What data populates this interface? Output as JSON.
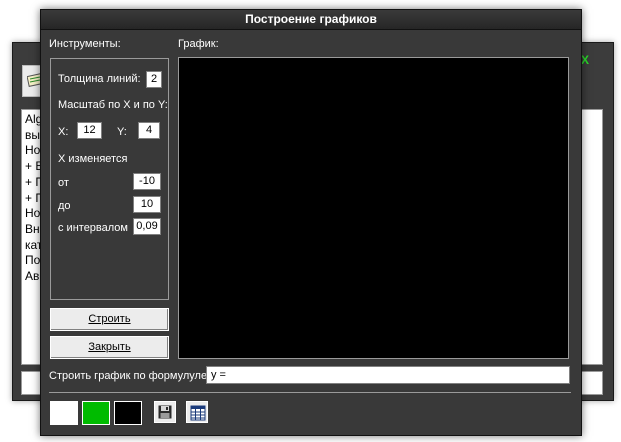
{
  "background_window": {
    "text_lines": [
      "Alg",
      "вы",
      "Но",
      "+ Е",
      "+ П",
      "+ П",
      "Но",
      "Вн",
      "кат",
      "По",
      "Ав"
    ]
  },
  "dialog": {
    "title": "Построение графиков",
    "tools_label": "Инструменты:",
    "graph_label": "График:",
    "line_width_label": "Толщина линий:",
    "line_width_value": "2",
    "scale_label": "Масштаб по X и по Y:",
    "x_label": "X:",
    "x_value": "12",
    "y_label": "Y:",
    "y_value": "4",
    "x_changes_label": "X изменяется",
    "from_label": "от",
    "from_value": "-10",
    "to_label": "до",
    "to_value": "10",
    "interval_label": "с интервалом",
    "interval_value": "0,09",
    "build_button": "Строить",
    "close_button": "Закрыть",
    "formula_label": "Строить график по формулуле:",
    "formula_value": "y ="
  },
  "colors": {
    "background_color": "#ffffff",
    "line_color": "#00bb00",
    "axis_color": "#000000",
    "graph_background": "#000000"
  }
}
